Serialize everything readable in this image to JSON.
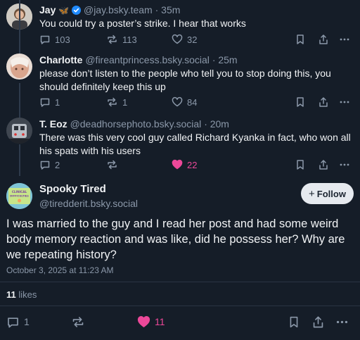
{
  "replies": [
    {
      "name": "Jay",
      "emoji": "🦋",
      "verified": true,
      "handle": "@jay.bsky.team",
      "time": "· 35m",
      "text": "You could try a poster’s strike. I hear that works",
      "replies_count": "103",
      "reposts_count": "113",
      "likes_count": "32",
      "liked": false
    },
    {
      "name": "Charlotte",
      "handle": "@fireantprincess.bsky.social",
      "time": "· 25m",
      "text": "please don’t listen to the people who tell you to stop doing this, you should definitely keep this up",
      "replies_count": "1",
      "reposts_count": "1",
      "likes_count": "84",
      "liked": false
    },
    {
      "name": "T. Eoz",
      "handle": "@deadhorsephoto.bsky.social",
      "time": "· 20m",
      "text": "There was this very cool guy called Richard Kyanka in fact, who won all his spats with his users",
      "replies_count": "2",
      "reposts_count": "",
      "likes_count": "22",
      "liked": true
    }
  ],
  "main_post": {
    "name": "Spooky Tired",
    "handle": "@tiredderit.bsky.social",
    "follow_label": "Follow",
    "text": "I was married to the guy and I read her post and had some weird body memory reaction and was like, did he possess her? Why are we repeating history?",
    "timestamp": "October 3, 2025 at 11:23 AM",
    "likes_summary_count": "11",
    "likes_summary_label": "likes",
    "replies_count": "1",
    "likes_count": "11",
    "liked": true,
    "avatar_text": "CLINICAL DIFFICULTIES"
  },
  "colors": {
    "background": "#151d28",
    "muted": "#8b98a9",
    "like_pink": "#ec4899",
    "verified_blue": "#208bfe"
  }
}
